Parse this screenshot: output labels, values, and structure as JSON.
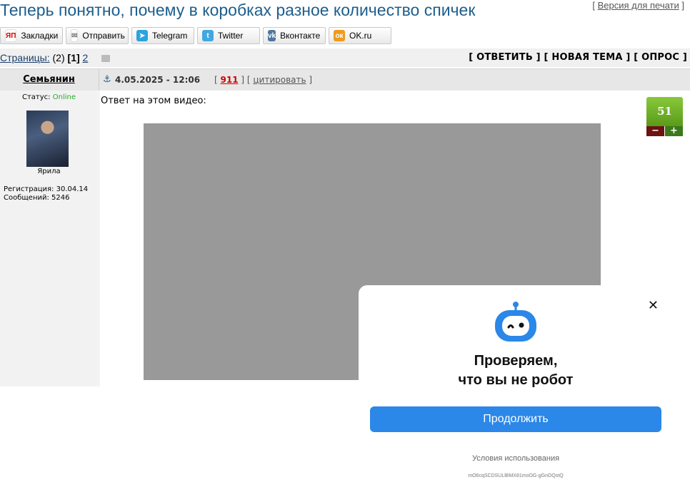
{
  "page": {
    "title": "Теперь понятно, почему в коробках разное количество спичек",
    "print_version": "Версия для печати"
  },
  "share": [
    {
      "label": "Закладки",
      "icon": "yandex-bookmarks-icon",
      "glyph": "ЯП",
      "color": "#ffffff",
      "text_color": "#d00000"
    },
    {
      "label": "Отправить",
      "icon": "mail-icon",
      "glyph": "✉",
      "color": "#ffffff",
      "text_color": "#777777"
    },
    {
      "label": "Telegram",
      "icon": "telegram-icon",
      "glyph": "➤",
      "color": "#2aa3df",
      "text_color": "#ffffff"
    },
    {
      "label": "Twitter",
      "icon": "twitter-icon",
      "glyph": "t",
      "color": "#41a8e0",
      "text_color": "#ffffff"
    },
    {
      "label": "Вконтакте",
      "icon": "vk-icon",
      "glyph": "vk",
      "color": "#4d76a1",
      "text_color": "#ffffff"
    },
    {
      "label": "OK.ru",
      "icon": "ok-icon",
      "glyph": "ок",
      "color": "#f09a1c",
      "text_color": "#ffffff"
    }
  ],
  "pagination": {
    "label": "Страницы:",
    "total": "(2)",
    "current": "[1]",
    "next": "2"
  },
  "actions": {
    "reply": "[ ОТВЕТИТЬ ]",
    "new_topic": "[ НОВАЯ ТЕМА ]",
    "poll": "[ ОПРОС ]"
  },
  "post": {
    "author": "Семьянин",
    "date": "4.05.2025 - 12:06",
    "number": "911",
    "quote": "цитировать",
    "status_label": "Статус:",
    "status_value": "Online",
    "avatar_caption": "Ярила",
    "registration": "Регистрация: 30.04.14",
    "messages": "Сообщений: 5246",
    "text": "Ответ на этом видео:",
    "rating": "51",
    "rating_minus": "−",
    "rating_plus": "+"
  },
  "captcha": {
    "title_line1": "Проверяем,",
    "title_line2": "что вы не робот",
    "button": "Продолжить",
    "terms": "Условия использования",
    "token": "mO6cqSCDSULlBMX81moOG-gGnOQstQ"
  },
  "colors": {
    "title": "#1d5e8c",
    "accent_button": "#2b87e8",
    "online": "#2aa82a",
    "rating_green": "#5a9a1a"
  }
}
